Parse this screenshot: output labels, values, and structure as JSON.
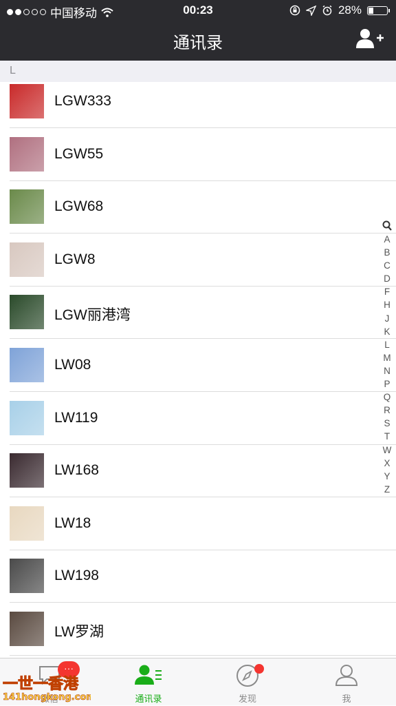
{
  "status_bar": {
    "carrier": "中国移动",
    "time": "00:23",
    "battery_percent": "28%",
    "battery_level": 0.28
  },
  "nav": {
    "title": "通讯录",
    "add_icon": "add-contact-icon"
  },
  "section": {
    "letter": "L"
  },
  "contacts": [
    {
      "name": "LGW333",
      "avatar_color": "#c92a2a"
    },
    {
      "name": "LGW55",
      "avatar_color": "#b07080"
    },
    {
      "name": "LGW68",
      "avatar_color": "#6a8a4a"
    },
    {
      "name": "LGW8",
      "avatar_color": "#d8c8c0"
    },
    {
      "name": "LGW丽港湾",
      "avatar_color": "#2a4a2a"
    },
    {
      "name": "LW08",
      "avatar_color": "#7fa3d8"
    },
    {
      "name": "LW119",
      "avatar_color": "#a8d0e8"
    },
    {
      "name": "LW168",
      "avatar_color": "#3a2a30"
    },
    {
      "name": "LW18",
      "avatar_color": "#e8d8c0"
    },
    {
      "name": "LW198",
      "avatar_color": "#4a4a4a"
    },
    {
      "name": "LW罗湖",
      "avatar_color": "#5a4a40"
    }
  ],
  "index_bar": [
    "A",
    "B",
    "C",
    "D",
    "F",
    "H",
    "J",
    "K",
    "L",
    "M",
    "N",
    "P",
    "Q",
    "R",
    "S",
    "T",
    "W",
    "X",
    "Y",
    "Z"
  ],
  "tabs": [
    {
      "label": "微信",
      "icon": "chat-icon"
    },
    {
      "label": "通讯录",
      "icon": "contacts-icon"
    },
    {
      "label": "发现",
      "icon": "compass-icon"
    },
    {
      "label": "我",
      "icon": "profile-icon"
    }
  ],
  "tab_badge": "···",
  "watermark": {
    "line1": "一世一香港",
    "line2": "141hongkong.com"
  },
  "colors": {
    "accent": "#1aad19",
    "badge": "#f43530",
    "nav_bg": "#2b2b2f"
  }
}
